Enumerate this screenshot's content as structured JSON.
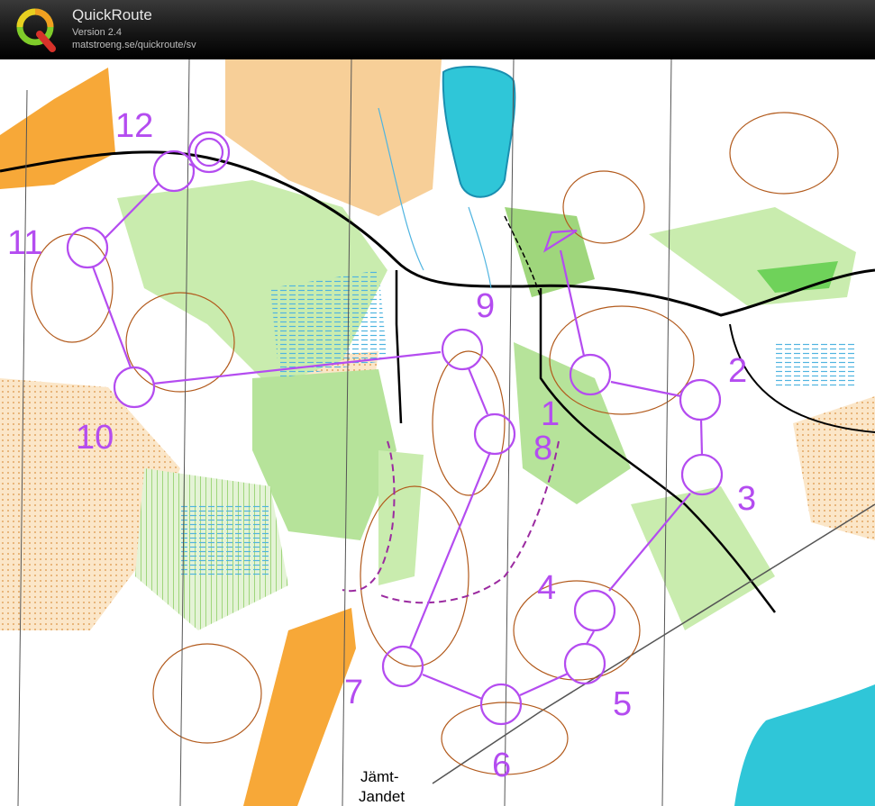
{
  "window": {
    "app_name": "QuickRoute",
    "version": "Version 2.4",
    "url": "matstroeng.se/quickroute/sv",
    "logo_letter": "Q"
  },
  "map": {
    "place_label_line1": "Jämt-",
    "place_label_line2": "Jandet",
    "course_color": "#b44cf0",
    "controls": [
      {
        "number": "1",
        "label": "1"
      },
      {
        "number": "2",
        "label": "2"
      },
      {
        "number": "3",
        "label": "3"
      },
      {
        "number": "4",
        "label": "4"
      },
      {
        "number": "5",
        "label": "5"
      },
      {
        "number": "6",
        "label": "6"
      },
      {
        "number": "7",
        "label": "7"
      },
      {
        "number": "8",
        "label": "8"
      },
      {
        "number": "9",
        "label": "9"
      },
      {
        "number": "10",
        "label": "10"
      },
      {
        "number": "11",
        "label": "11"
      },
      {
        "number": "12",
        "label": "12"
      }
    ]
  }
}
